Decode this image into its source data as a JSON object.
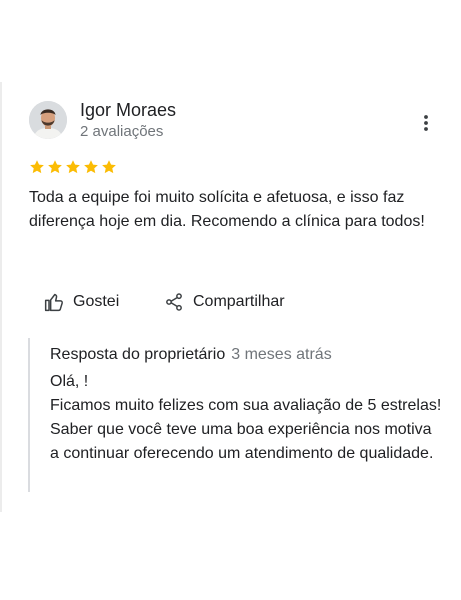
{
  "review": {
    "author": "Igor Moraes",
    "review_count": "2 avaliações",
    "rating": 5,
    "star_color": "#fbbc04",
    "text": "Toda a equipe foi muito solícita e afetuosa, e isso faz diferença hoje em dia. Recomendo a clínica para todos!"
  },
  "actions": {
    "like_label": "Gostei",
    "share_label": "Compartilhar"
  },
  "reply": {
    "label": "Resposta do proprietário",
    "time": "3 meses atrás",
    "text": " Olá, !\n Ficamos muito felizes com sua avaliação de 5 estrelas! Saber que você teve uma boa experiência nos motiva a continuar oferecendo um atendimento de qualidade."
  },
  "icons": {
    "more": "more-vert-icon",
    "like": "thumb-up-icon",
    "share": "share-icon",
    "star": "star-icon"
  }
}
